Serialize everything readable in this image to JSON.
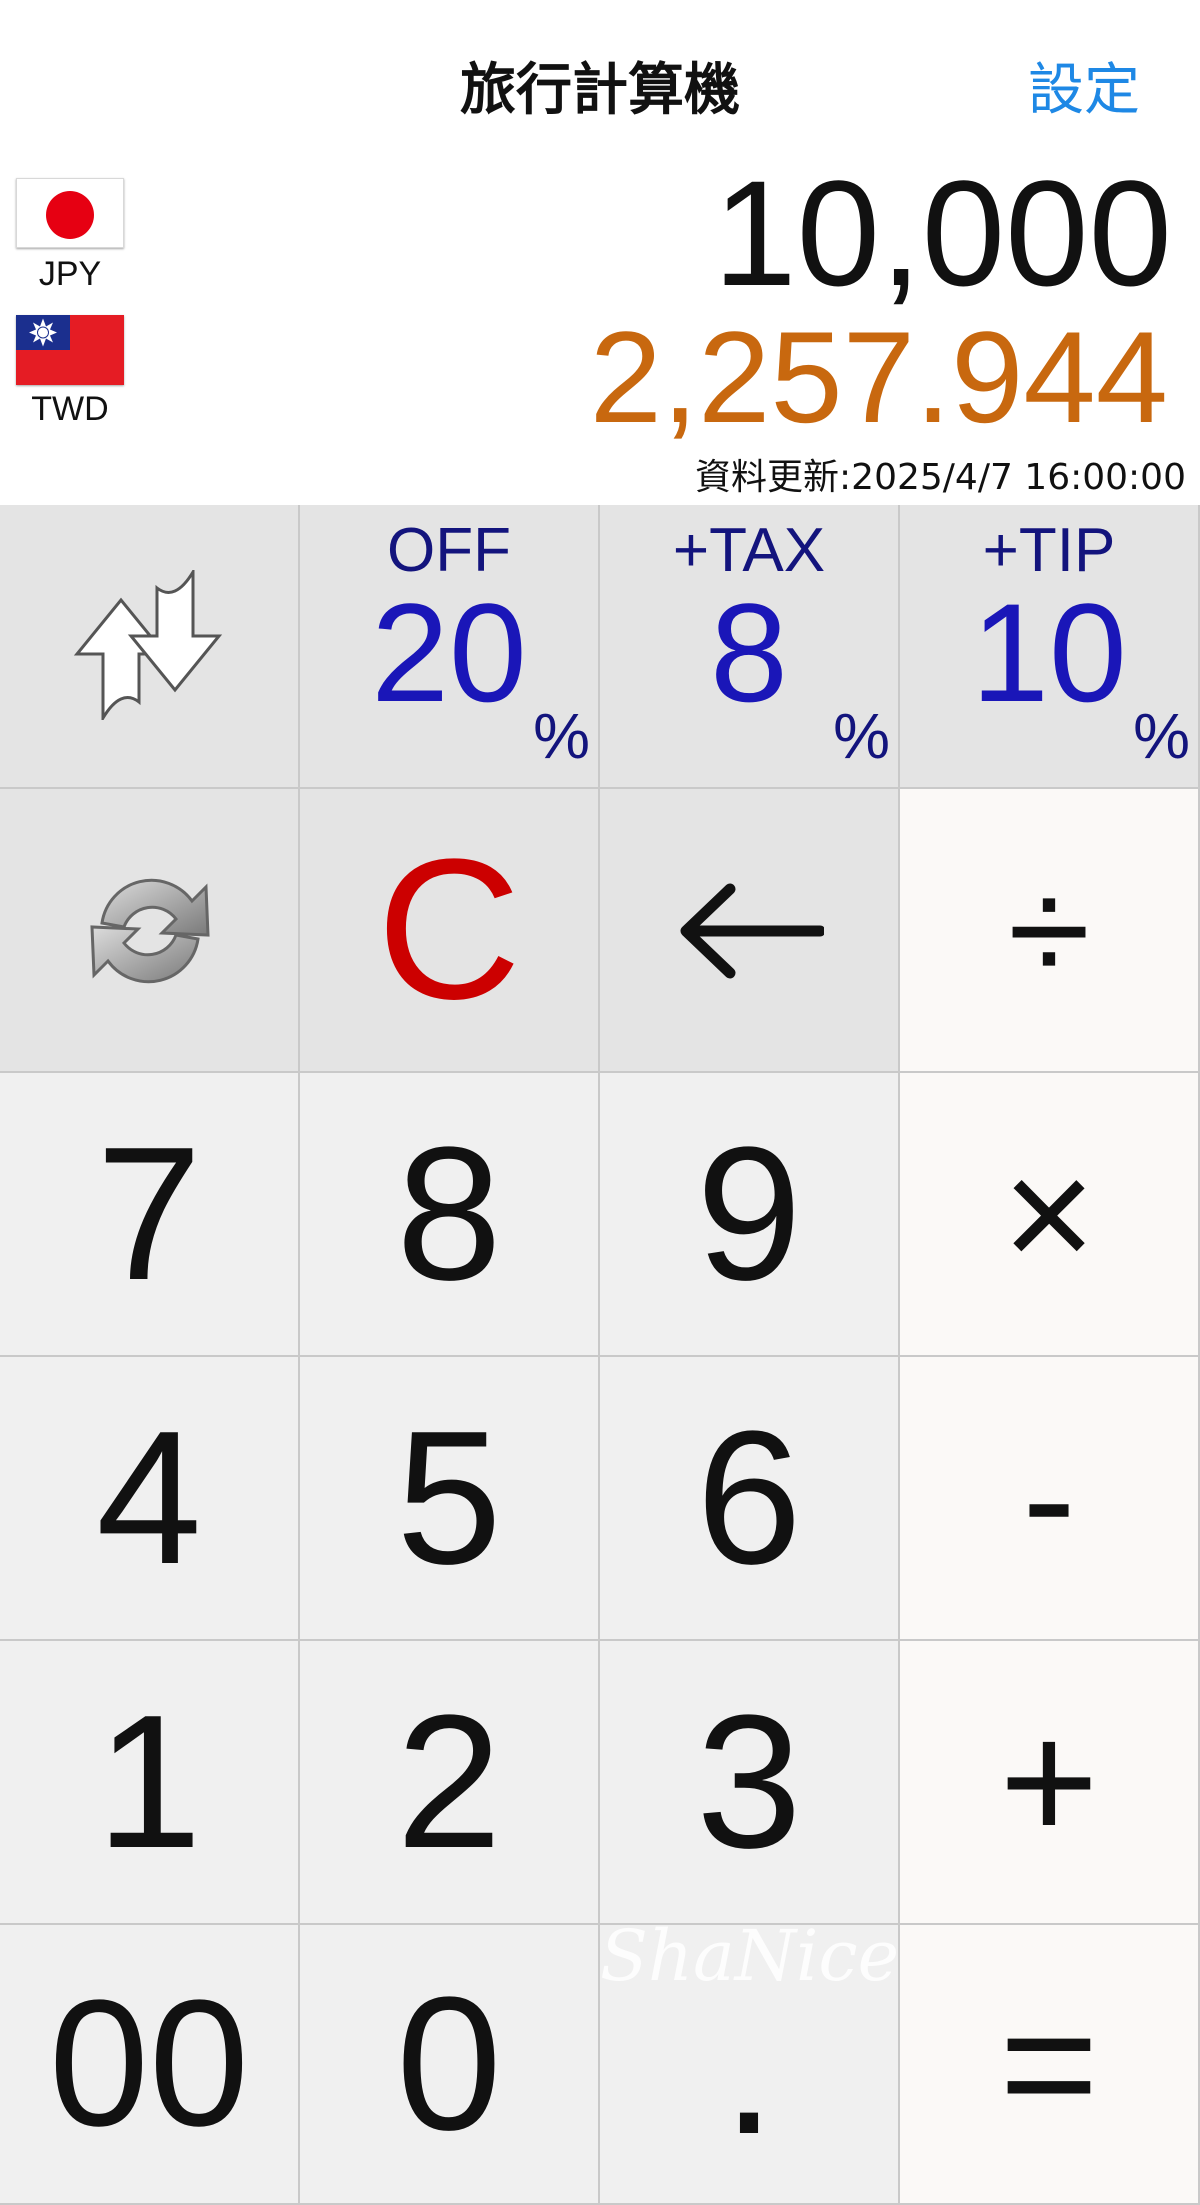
{
  "header": {
    "title": "旅行計算機",
    "settings_label": "設定"
  },
  "currencies": {
    "from": {
      "code": "JPY",
      "flag": "japan-flag-icon",
      "amount": "10,000"
    },
    "to": {
      "code": "TWD",
      "flag": "taiwan-flag-icon",
      "amount": "2,257.944"
    }
  },
  "update_info": "資料更新:2025/4/7 16:00:00",
  "adjustments": [
    {
      "title": "OFF",
      "value": "20",
      "unit": "%"
    },
    {
      "title": "+TAX",
      "value": "8",
      "unit": "%"
    },
    {
      "title": "+TIP",
      "value": "10",
      "unit": "%"
    }
  ],
  "keys": {
    "clear": "C",
    "backspace": "←",
    "divide": "÷",
    "multiply": "×",
    "minus": "-",
    "plus": "+",
    "equals": "=",
    "decimal": ".",
    "double_zero": "00",
    "digits": [
      "0",
      "1",
      "2",
      "3",
      "4",
      "5",
      "6",
      "7",
      "8",
      "9"
    ]
  },
  "watermark": "ShaNice",
  "colors": {
    "accent": "#1e88e5",
    "converted_amount": "#c8680f",
    "clear_key": "#cc0000",
    "percent_value": "#1a16b8"
  }
}
